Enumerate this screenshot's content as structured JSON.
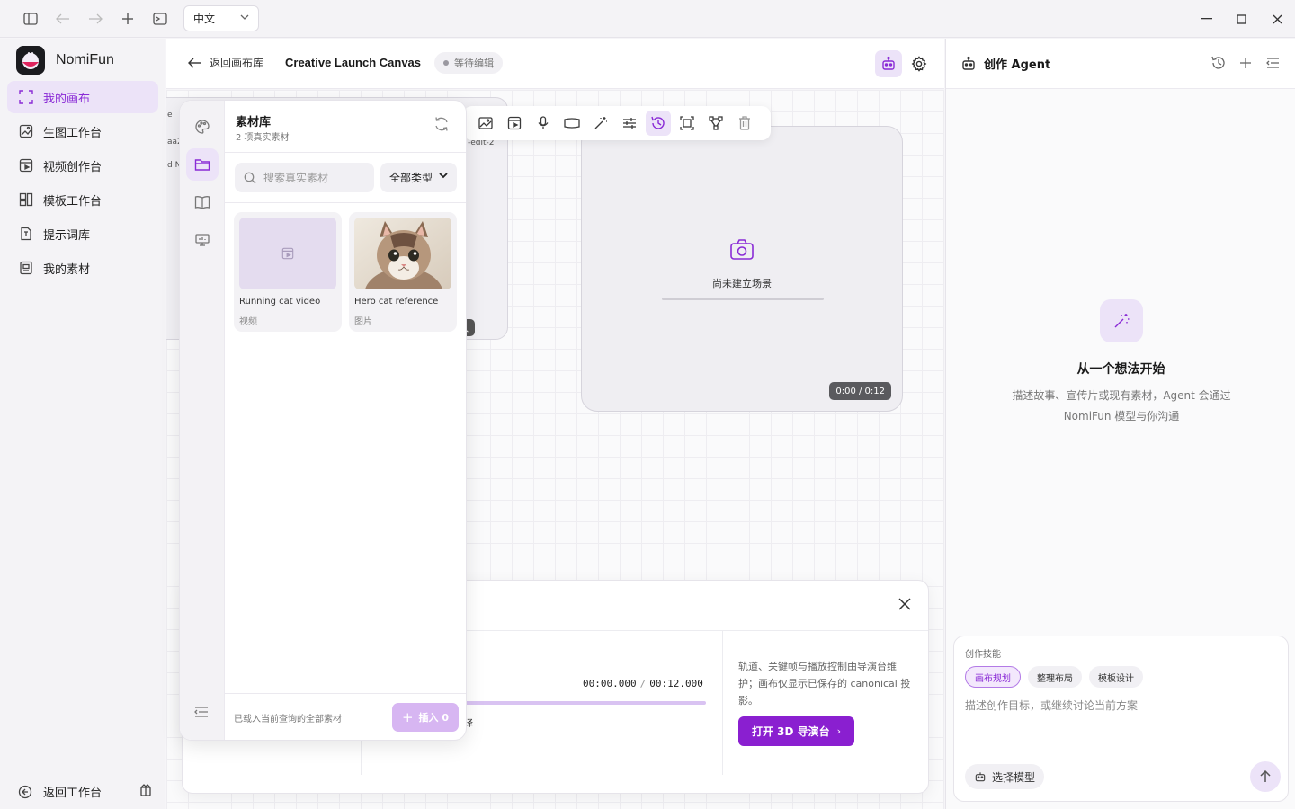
{
  "titlebar": {
    "language": "中文"
  },
  "app": {
    "name": "NomiFun"
  },
  "sidebar": {
    "items": [
      {
        "label": "我的画布",
        "icon": "canvas-icon",
        "active": true
      },
      {
        "label": "生图工作台",
        "icon": "image-studio-icon",
        "active": false
      },
      {
        "label": "视频创作台",
        "icon": "video-studio-icon",
        "active": false
      },
      {
        "label": "模板工作台",
        "icon": "template-icon",
        "active": false
      },
      {
        "label": "提示词库",
        "icon": "prompt-library-icon",
        "active": false
      },
      {
        "label": "我的素材",
        "icon": "assets-icon",
        "active": false
      }
    ],
    "footer": {
      "back_label": "返回工作台"
    }
  },
  "header": {
    "back_label": "返回画布库",
    "title": "Creative Launch Canvas",
    "status": "等待编辑"
  },
  "canvas": {
    "left_node": {
      "fragments": [
        "e",
        "aa2",
        "d N"
      ],
      "insert_tag": "输入",
      "edit_label": "-edit-2"
    },
    "scene_node": {
      "empty_label": "尚未建立场景",
      "time": "0:00 / 0:12"
    }
  },
  "library": {
    "title": "素材库",
    "subtitle": "2 项真实素材",
    "search_placeholder": "搜索真实素材",
    "type_filter": "全部类型",
    "items": [
      {
        "name": "Running cat video",
        "type": "视频"
      },
      {
        "name": "Hero cat reference",
        "type": "图片"
      }
    ],
    "footer_hint": "已载入当前查询的全部素材",
    "insert_label": "插入 0"
  },
  "director": {
    "current_time": "00:00.000",
    "sep": "/",
    "total_time": "00:12.000",
    "track_fragment": "译",
    "note": "轨道、关键帧与播放控制由导演台维护；画布仅显示已保存的 canonical 投影。",
    "open_button": "打开 3D 导演台",
    "open_chevron": "›"
  },
  "agent": {
    "title": "创作 Agent",
    "empty_title": "从一个想法开始",
    "empty_desc": "描述故事、宣传片或现有素材，Agent 会通过 NomiFun 模型与你沟通",
    "composer": {
      "skills_label": "创作技能",
      "chips": [
        {
          "label": "画布规划",
          "active": true
        },
        {
          "label": "整理布局",
          "active": false
        },
        {
          "label": "模板设计",
          "active": false
        }
      ],
      "placeholder": "描述创作目标，或继续讨论当前方案",
      "model_button": "选择模型"
    }
  },
  "colors": {
    "accent": "#8a2bd6",
    "accent_soft": "#ece3f8"
  }
}
